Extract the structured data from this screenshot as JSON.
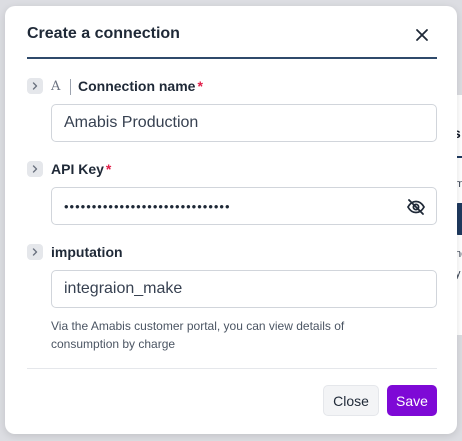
{
  "modal": {
    "title": "Create a connection"
  },
  "fields": {
    "connection_name": {
      "type_letter": "A",
      "label": "Connection name",
      "required_mark": "*",
      "value": "Amabis Production"
    },
    "api_key": {
      "label": "API Key",
      "required_mark": "*",
      "masked_value": "••••••••••••••••••••••••••••••"
    },
    "imputation": {
      "label": "imputation",
      "value": "integraion_make",
      "help_line1": "Via the Amabis customer portal, you can view details of",
      "help_line2": "consumption by charge"
    }
  },
  "footer": {
    "close_label": "Close",
    "save_label": "Save"
  },
  "background": {
    "tab_letter": "s",
    "text_1": "m",
    "text_2": "nc",
    "text_3": "y"
  },
  "colors": {
    "accent": "#7e09d6",
    "header_rule": "#2f4a6b",
    "required": "#e11d48"
  },
  "icons": {
    "close": "close-icon",
    "expand": "chevron-right-icon",
    "visibility": "eye-off-icon"
  }
}
